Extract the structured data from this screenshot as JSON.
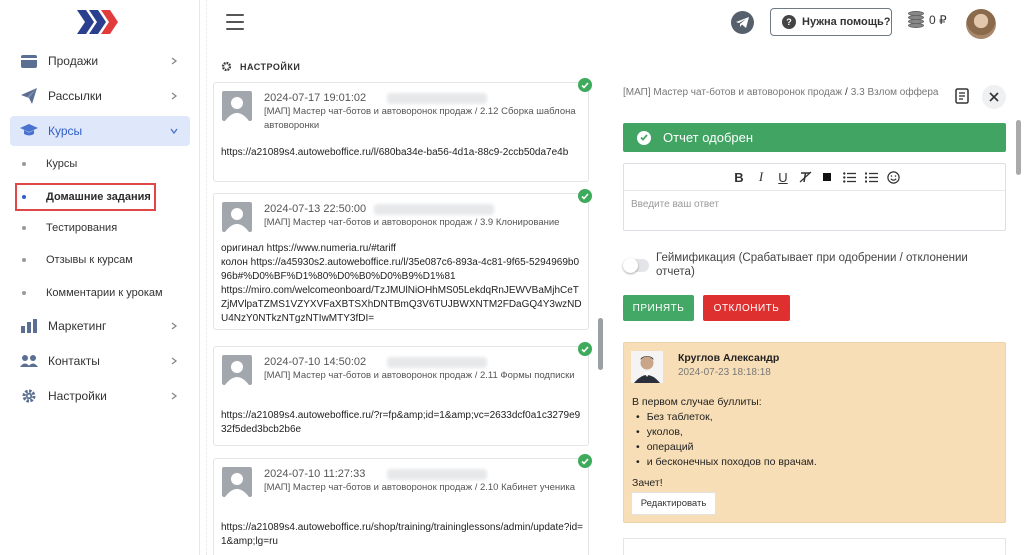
{
  "sidebar": {
    "items": [
      {
        "label": "Продажи",
        "icon": "cart-icon"
      },
      {
        "label": "Рассылки",
        "icon": "paper-plane-icon"
      },
      {
        "label": "Курсы",
        "icon": "graduation-cap-icon"
      },
      {
        "label": "Маркетинг",
        "icon": "chart-bars-icon"
      },
      {
        "label": "Контакты",
        "icon": "users-icon"
      },
      {
        "label": "Настройки",
        "icon": "gear-icon"
      }
    ],
    "courses_sub": [
      {
        "label": "Курсы"
      },
      {
        "label": "Домашние задания"
      },
      {
        "label": "Тестирования"
      },
      {
        "label": "Отзывы к курсам"
      },
      {
        "label": "Комментарии к урокам"
      }
    ]
  },
  "header": {
    "help_label": "Нужна помощь?",
    "balance": "0 ₽"
  },
  "section_title": "НАСТРОЙКИ",
  "submissions": [
    {
      "date": "2024-07-17 19:01:02",
      "path": "[МАП] Мастер чат-ботов и автоворонок продаж / 2.12 Сборка шаблона автоворонки",
      "body": "https://a21089s4.autoweboffice.ru/l/680ba34e-ba56-4d1a-88c9-2ccb50da7e4b"
    },
    {
      "date": "2024-07-13 22:50:00",
      "path": "[МАП] Мастер чат-ботов и автоворонок продаж / 3.9 Клонирование",
      "body": "оригинал https://www.numeria.ru/#tariff\nколон https://a45930s2.autoweboffice.ru/l/35e087c6-893a-4c81-9f65-5294969b096b#%D0%BF%D1%80%D0%B0%D0%B9%D1%81\nhttps://miro.com/welcomeonboard/TzJMUlNiOHhMS05LekdqRnJEWVBaMjhCeTZjMVlpaTZMS1VZYXVFaXBTSXhDNTBmQ3V6TUJBWXNTM2FDaGQ4Y3wzNDU4NzY0NTkzNTgzNTIwMTY3fDI="
    },
    {
      "date": "2024-07-10 14:50:02",
      "path": "[МАП] Мастер чат-ботов и автоворонок продаж / 2.11 Формы подписки",
      "body": "https://a21089s4.autoweboffice.ru/?r=fp&amp;id=1&amp;vc=2633dcf0a1c3279e932f5ded3bcb2b6e"
    },
    {
      "date": "2024-07-10 11:27:33",
      "path": "[МАП] Мастер чат-ботов и автоворонок продаж / 2.10 Кабинет ученика",
      "body": "https://a21089s4.autoweboffice.ru/shop/training/traininglessons/admin/update?id=1&amp;lg=ru"
    }
  ],
  "detail": {
    "course": "[МАП] Мастер чат-ботов и автоворонок продаж",
    "separator": "/",
    "lesson": "3.3 Взлом оффера",
    "status": "Отчет одобрен",
    "editor_placeholder": "Введите ваш ответ",
    "gamification_label": "Геймификация (Срабатывает при одобрении / отклонении отчета)",
    "accept_label": "ПРИНЯТЬ",
    "reject_label": "ОТКЛОНИТЬ",
    "comment": {
      "author": "Круглов Александр",
      "date": "2024-07-23 18:18:18",
      "intro": "В первом случае буллиты:",
      "bullets": [
        "Без таблеток,",
        "уколов,",
        "операций",
        "и бесконечных походов по врачам."
      ],
      "outro": "Зачет!",
      "edit_label": "Редактировать"
    }
  },
  "colors": {
    "accent": "#2f5ec8",
    "success": "#42a463",
    "danger": "#df3030",
    "comment_bg": "#f8deb6",
    "highlight": "#e04747"
  }
}
